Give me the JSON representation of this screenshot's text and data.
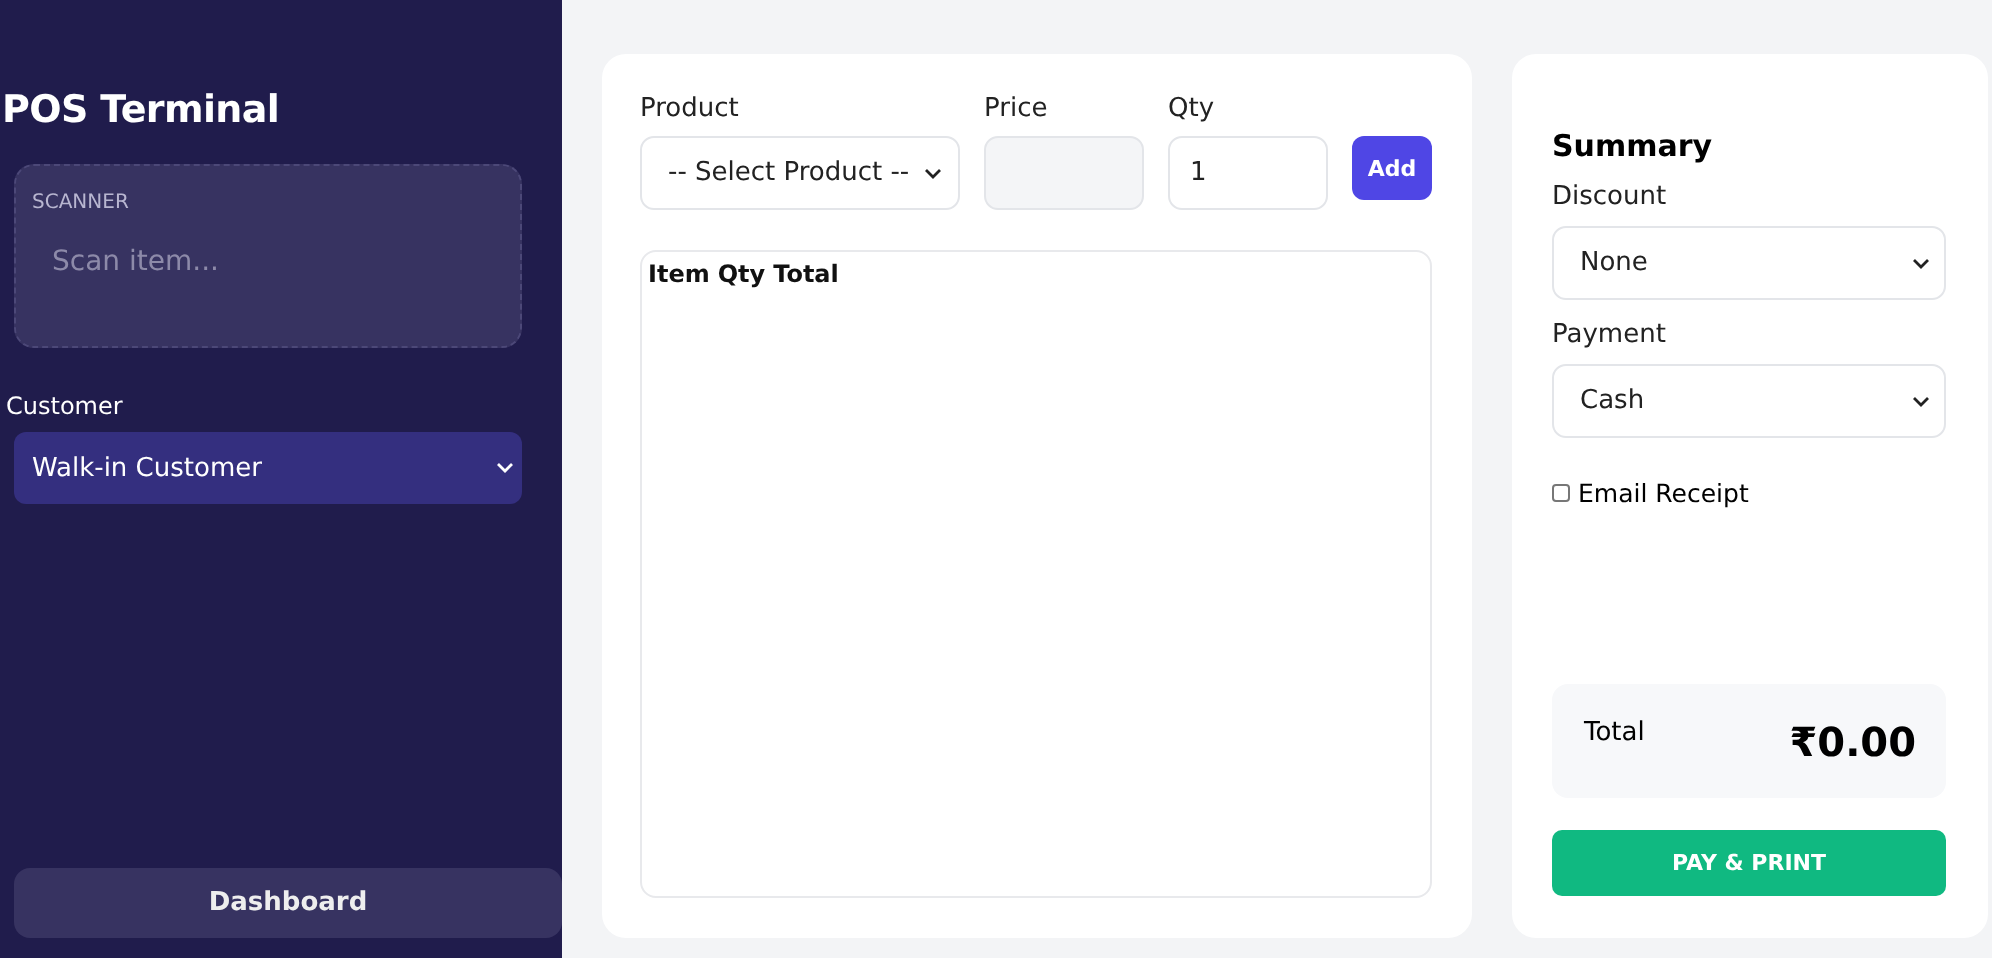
{
  "sidebar": {
    "title": "POS Terminal",
    "scanner": {
      "label": "SCANNER",
      "placeholder": "Scan item..."
    },
    "customer": {
      "label": "Customer",
      "value": "Walk-in Customer"
    },
    "dashboard_button": "Dashboard"
  },
  "entry": {
    "product": {
      "label": "Product",
      "value": "-- Select Product --"
    },
    "price": {
      "label": "Price"
    },
    "qty": {
      "label": "Qty",
      "value": "1"
    },
    "add_button": "Add"
  },
  "table": {
    "columns": [
      "Item",
      "Qty",
      "Total"
    ]
  },
  "summary": {
    "title": "Summary",
    "discount": {
      "label": "Discount",
      "value": "None"
    },
    "payment": {
      "label": "Payment",
      "value": "Cash"
    },
    "email_receipt": {
      "label": "Email Receipt",
      "checked": false
    },
    "total_label": "Total",
    "total_value": "₹0.00",
    "pay_button": "PAY & PRINT"
  }
}
